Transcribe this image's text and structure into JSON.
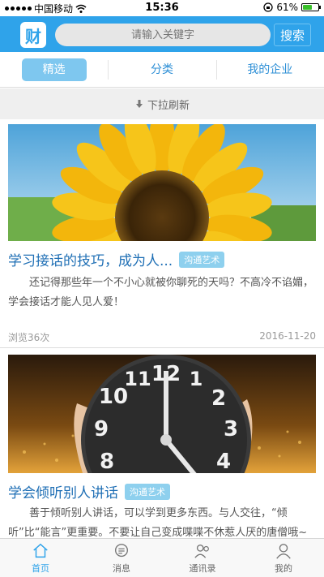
{
  "status_bar": {
    "carrier": "中国移动",
    "time": "15:36",
    "battery": "61%",
    "battery_level": 0.61
  },
  "header": {
    "logo_text": "财",
    "search_placeholder": "请输入关键字",
    "search_button": "搜索"
  },
  "tabs": [
    {
      "label": "精选",
      "active": true
    },
    {
      "label": "分类",
      "active": false
    },
    {
      "label": "我的企业",
      "active": false
    }
  ],
  "refresh_hint": "下拉刷新",
  "articles": [
    {
      "title": "学习接话的技巧，成为人...",
      "tag": "沟通艺术",
      "description": "还记得那些年一个不小心就被你聊死的天吗？不高冷不谄媚，学会接话才能人见人爱！",
      "views": "浏览36次",
      "date": "2016-11-20",
      "image": "sunflower"
    },
    {
      "title": "学会倾听别人讲话",
      "tag": "沟通艺术",
      "description": "善于倾听别人讲话，可以学到更多东西。与人交往，“倾听”比“能言”更重要。不要让自己变成喋喋不休惹人厌的唐僧哦~",
      "image": "clock"
    }
  ],
  "bottom_nav": [
    {
      "label": "首页",
      "icon": "home-icon",
      "active": true
    },
    {
      "label": "消息",
      "icon": "message-icon",
      "active": false
    },
    {
      "label": "通讯录",
      "icon": "contacts-icon",
      "active": false
    },
    {
      "label": "我的",
      "icon": "profile-icon",
      "active": false
    }
  ],
  "colors": {
    "accent": "#2fa3ea",
    "tag": "#8ed0ee",
    "title": "#1f6fb5"
  }
}
